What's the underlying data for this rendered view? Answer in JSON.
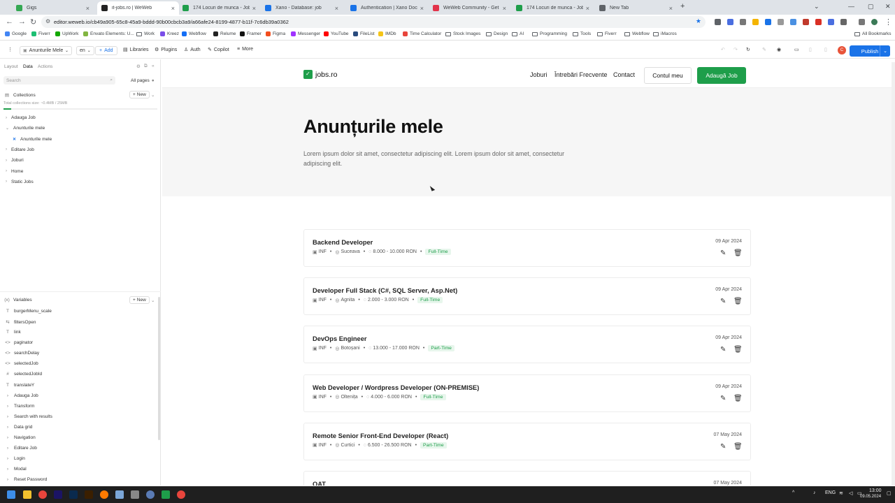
{
  "browser": {
    "tabs": [
      {
        "title": "Gigs",
        "color": "#34a853",
        "active": false
      },
      {
        "title": "it-jobs.ro | WeWeb",
        "color": "#222222",
        "active": true
      },
      {
        "title": "174 Locuri de munca - Joburi I",
        "color": "#1e9e4a",
        "active": false
      },
      {
        "title": "Xano - Database: job",
        "color": "#1a73e8",
        "active": false
      },
      {
        "title": "Authentication | Xano Docume",
        "color": "#1a73e8",
        "active": false
      },
      {
        "title": "WeWeb Community - Get help",
        "color": "#e2334a",
        "active": false
      },
      {
        "title": "174 Locuri de munca - Joburi I",
        "color": "#1e9e4a",
        "active": false
      },
      {
        "title": "New Tab",
        "color": "#5f6368",
        "active": false
      }
    ],
    "new_tab_icon": "plus-icon",
    "url": "editor.weweb.io/cb49a905-65c8-45a9-bddd-90b00cbcb3a9/a66afe24-8199-4877-b11f-7c6db39a0362",
    "bookmarks": [
      {
        "label": "Google",
        "type": "site",
        "color": "#4285f4"
      },
      {
        "label": "Fiverr",
        "type": "site",
        "color": "#1dbf73"
      },
      {
        "label": "UpWork",
        "type": "site",
        "color": "#14a800"
      },
      {
        "label": "Envato Elements: U...",
        "type": "site",
        "color": "#82b541"
      },
      {
        "label": "Work",
        "type": "folder"
      },
      {
        "label": "Kreez",
        "type": "site",
        "color": "#7a4ee8"
      },
      {
        "label": "Webflow",
        "type": "site",
        "color": "#146ef5"
      },
      {
        "label": "Relume",
        "type": "site",
        "color": "#222222"
      },
      {
        "label": "Framer",
        "type": "site",
        "color": "#111111"
      },
      {
        "label": "Figma",
        "type": "site",
        "color": "#f24e1e"
      },
      {
        "label": "Messenger",
        "type": "site",
        "color": "#a033ff"
      },
      {
        "label": "YouTube",
        "type": "site",
        "color": "#ff0000"
      },
      {
        "label": "FileList",
        "type": "site",
        "color": "#2b4c7e"
      },
      {
        "label": "IMDb",
        "type": "site",
        "color": "#f5c518"
      },
      {
        "label": "Time Calculator",
        "type": "site",
        "color": "#e8453c"
      },
      {
        "label": "Stock Images",
        "type": "folder"
      },
      {
        "label": "Design",
        "type": "folder"
      },
      {
        "label": "AI",
        "type": "folder"
      },
      {
        "label": "Programming",
        "type": "folder"
      },
      {
        "label": "Tools",
        "type": "folder"
      },
      {
        "label": "Fiverr",
        "type": "folder"
      },
      {
        "label": "Webflow",
        "type": "folder"
      },
      {
        "label": "iMacros",
        "type": "folder"
      }
    ],
    "all_bookmarks": "All Bookmarks"
  },
  "editor": {
    "page_select": "Anunturile Mele",
    "lang": "en",
    "add": "Add",
    "libraries": "Libraries",
    "plugins": "Plugins",
    "auth": "Auth",
    "copilot": "Copilot",
    "more": "More",
    "publish": "Publish",
    "panel_tabs": [
      "Layout",
      "Data",
      "Actions"
    ],
    "search_placeholder": "Search",
    "all_pages": "All pages",
    "collections_title": "Collections",
    "new_label": "New",
    "collections_size": "Total collections size: ~0.4MB / 25MB",
    "collections": [
      {
        "label": "Adauga Job",
        "level": 0
      },
      {
        "label": "Anunturile mele",
        "level": 0,
        "open": true
      },
      {
        "label": "Anunturile mele",
        "level": 1
      },
      {
        "label": "Editare Job",
        "level": 0
      },
      {
        "label": "Joburi",
        "level": 0
      },
      {
        "label": "Home",
        "level": 0
      },
      {
        "label": "Static Jobs",
        "level": 0
      }
    ],
    "variables_title": "Variables",
    "variables": [
      {
        "label": "burgerMenu_scale",
        "icon": "T"
      },
      {
        "label": "filtersOpen",
        "icon": "⇆"
      },
      {
        "label": "link",
        "icon": "T"
      },
      {
        "label": "paginator",
        "icon": "<>"
      },
      {
        "label": "searchDelay",
        "icon": "<>"
      },
      {
        "label": "selectedJob",
        "icon": "<>"
      },
      {
        "label": "selectedJobId",
        "icon": "#"
      },
      {
        "label": "translateY",
        "icon": "T"
      },
      {
        "label": "Adauga Job",
        "icon": "›"
      },
      {
        "label": "Transform",
        "icon": "›"
      },
      {
        "label": "Search with results",
        "icon": "›"
      },
      {
        "label": "Data grid",
        "icon": "›"
      },
      {
        "label": "Navigation",
        "icon": "›"
      },
      {
        "label": "Editare Job",
        "icon": "›"
      },
      {
        "label": "Login",
        "icon": "›"
      },
      {
        "label": "Modal",
        "icon": "›"
      },
      {
        "label": "Reset Password",
        "icon": "›"
      }
    ]
  },
  "site": {
    "logo_text": "jobs.ro",
    "nav": [
      "Joburi",
      "Întrebări Frecvente",
      "Contact"
    ],
    "account_button": "Contul meu",
    "add_job_button": "Adaugă Job",
    "hero_title": "Anunțurile mele",
    "hero_desc": "Lorem ipsum dolor sit amet, consectetur adipiscing elit. Lorem ipsum dolor sit amet, consectetur adipiscing elit.",
    "jobs": [
      {
        "title": "Backend Developer",
        "dept": "INF",
        "city": "Suceava",
        "salary": "8.000 - 10.000 RON",
        "type": "Full-Time",
        "date": "09 Apr 2024"
      },
      {
        "title": "Developer Full Stack (C#, SQL Server, Asp.Net)",
        "dept": "INF",
        "city": "Agnita",
        "salary": "2.000 - 3.000 RON",
        "type": "Full-Time",
        "date": "09 Apr 2024"
      },
      {
        "title": "DevOps Engineer",
        "dept": "INF",
        "city": "Botoșani",
        "salary": "13.000 - 17.000 RON",
        "type": "Part-Time",
        "date": "09 Apr 2024"
      },
      {
        "title": "Web Developer / Wordpress Developer (ON-PREMISE)",
        "dept": "INF",
        "city": "Oltenița",
        "salary": "4.000 - 6.000 RON",
        "type": "Full-Time",
        "date": "09 Apr 2024"
      },
      {
        "title": "Remote Senior Front-End Developer (React)",
        "dept": "INF",
        "city": "Curtici",
        "salary": "6.500 - 26.500 RON",
        "type": "Part-Time",
        "date": "07 May 2024"
      },
      {
        "title": "QAT",
        "dept": "",
        "city": "",
        "salary": "",
        "type": "",
        "date": "07 May 2024"
      }
    ]
  },
  "taskbar": {
    "lang": "ENG",
    "time": "13:00",
    "date": "09.05.2024"
  }
}
